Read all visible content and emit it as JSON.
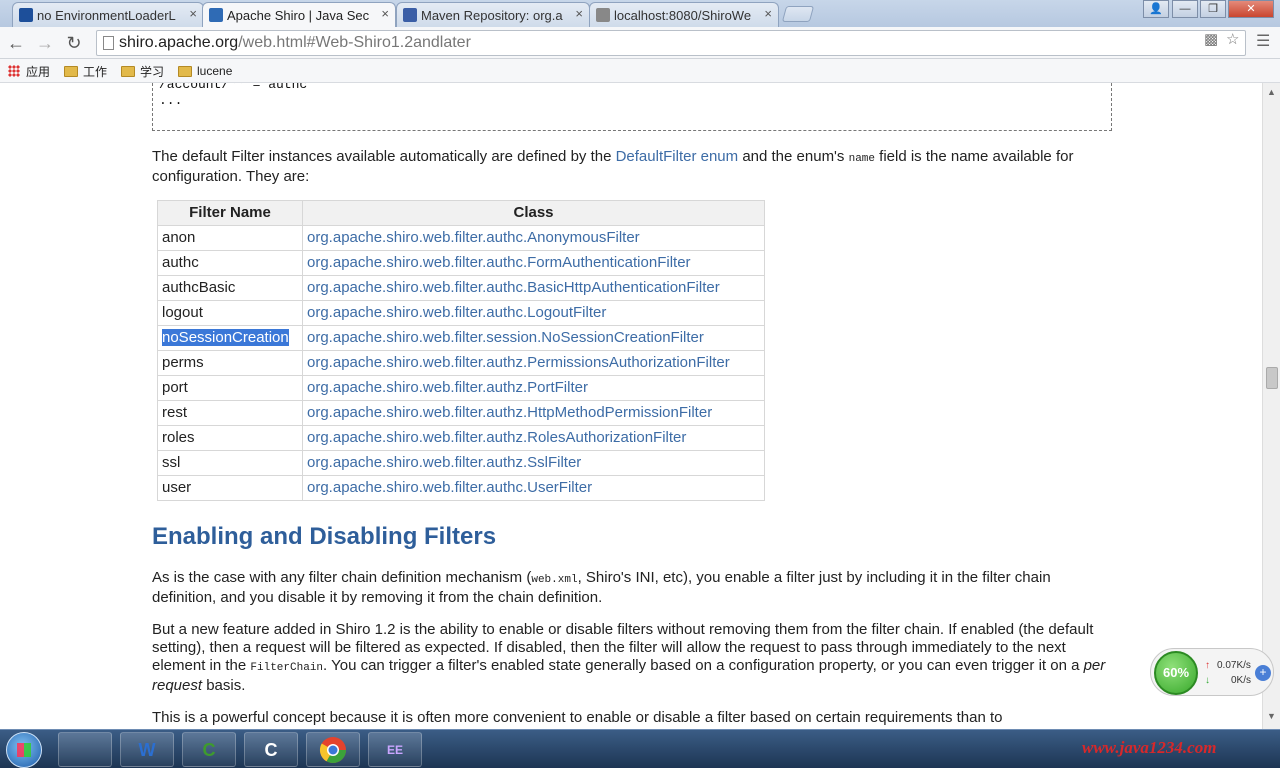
{
  "tabs": [
    {
      "title": "no EnvironmentLoaderL",
      "favicon_color": "#1d4f9a"
    },
    {
      "title": "Apache Shiro | Java Sec",
      "favicon_color": "#2f6bb5"
    },
    {
      "title": "Maven Repository: org.a",
      "favicon_color": "#3b5ea6"
    },
    {
      "title": "localhost:8080/ShiroWe",
      "favicon_color": "#888888"
    }
  ],
  "window_controls": {
    "user": "👤",
    "minimize": "—",
    "restore": "❐",
    "close": "✕"
  },
  "address": {
    "host": "shiro.apache.org",
    "path": "/web.html#Web-Shiro1.2andlater"
  },
  "bookmarks": {
    "apps": "应用",
    "folders": [
      "工作",
      "学习",
      "lucene"
    ]
  },
  "code_snippet": {
    "line1": "/account/** = authc",
    "line2": "..."
  },
  "intro": {
    "before_link": "The default Filter instances available automatically are defined by the ",
    "link": "DefaultFilter enum",
    "middle": " and the enum's ",
    "code": "name",
    "after": " field is the name available for configuration. They are:"
  },
  "filter_table": {
    "headers": [
      "Filter Name",
      "Class"
    ],
    "rows": [
      {
        "name": "anon",
        "class": "org.apache.shiro.web.filter.authc.AnonymousFilter"
      },
      {
        "name": "authc",
        "class": "org.apache.shiro.web.filter.authc.FormAuthenticationFilter"
      },
      {
        "name": "authcBasic",
        "class": "org.apache.shiro.web.filter.authc.BasicHttpAuthenticationFilter"
      },
      {
        "name": "logout",
        "class": "org.apache.shiro.web.filter.authc.LogoutFilter"
      },
      {
        "name": "noSessionCreation",
        "class": "org.apache.shiro.web.filter.session.NoSessionCreationFilter"
      },
      {
        "name": "perms",
        "class": "org.apache.shiro.web.filter.authz.PermissionsAuthorizationFilter"
      },
      {
        "name": "port",
        "class": "org.apache.shiro.web.filter.authz.PortFilter"
      },
      {
        "name": "rest",
        "class": "org.apache.shiro.web.filter.authz.HttpMethodPermissionFilter"
      },
      {
        "name": "roles",
        "class": "org.apache.shiro.web.filter.authz.RolesAuthorizationFilter"
      },
      {
        "name": "ssl",
        "class": "org.apache.shiro.web.filter.authz.SslFilter"
      },
      {
        "name": "user",
        "class": "org.apache.shiro.web.filter.authc.UserFilter"
      }
    ],
    "selected_index": 4
  },
  "section": {
    "heading": "Enabling and Disabling Filters",
    "p1_before": "As is the case with any filter chain definition mechanism (",
    "p1_code": "web.xml",
    "p1_after": ", Shiro's INI, etc), you enable a filter just by including it in the filter chain definition, and you disable it by removing it from the chain definition.",
    "p2_before": "But a new feature added in Shiro 1.2 is the ability to enable or disable filters without removing them from the filter chain. If enabled (the default setting), then a request will be filtered as expected. If disabled, then the filter will allow the request to pass through immediately to the next element in the ",
    "p2_code": "FilterChain",
    "p2_after": ". You can trigger a filter's enabled state generally based on a configuration property, or you can even trigger it on a ",
    "p2_em": "per request",
    "p2_end": " basis.",
    "p3": "This is a powerful concept because it is often more convenient to enable or disable a filter based on certain requirements than to"
  },
  "speed_widget": {
    "percent": "60%",
    "up": "0.07K/s",
    "down": "0K/s",
    "plus": "+"
  },
  "taskbar": {
    "items": [
      {
        "label": "",
        "color": "#e8a23a"
      },
      {
        "label": "W",
        "color": "#2b6fd1"
      },
      {
        "label": "C",
        "color": "#3e9b2e"
      },
      {
        "label": "C",
        "color": "#ffffff"
      },
      {
        "label": "",
        "color": "#e4432d"
      },
      {
        "label": "EE",
        "color": "#6d4aa0"
      }
    ],
    "watermark": "www.java1234.com"
  },
  "colors": {
    "link": "#3d6ca6",
    "heading": "#2e5e9a",
    "selection": "#3b78d8"
  }
}
